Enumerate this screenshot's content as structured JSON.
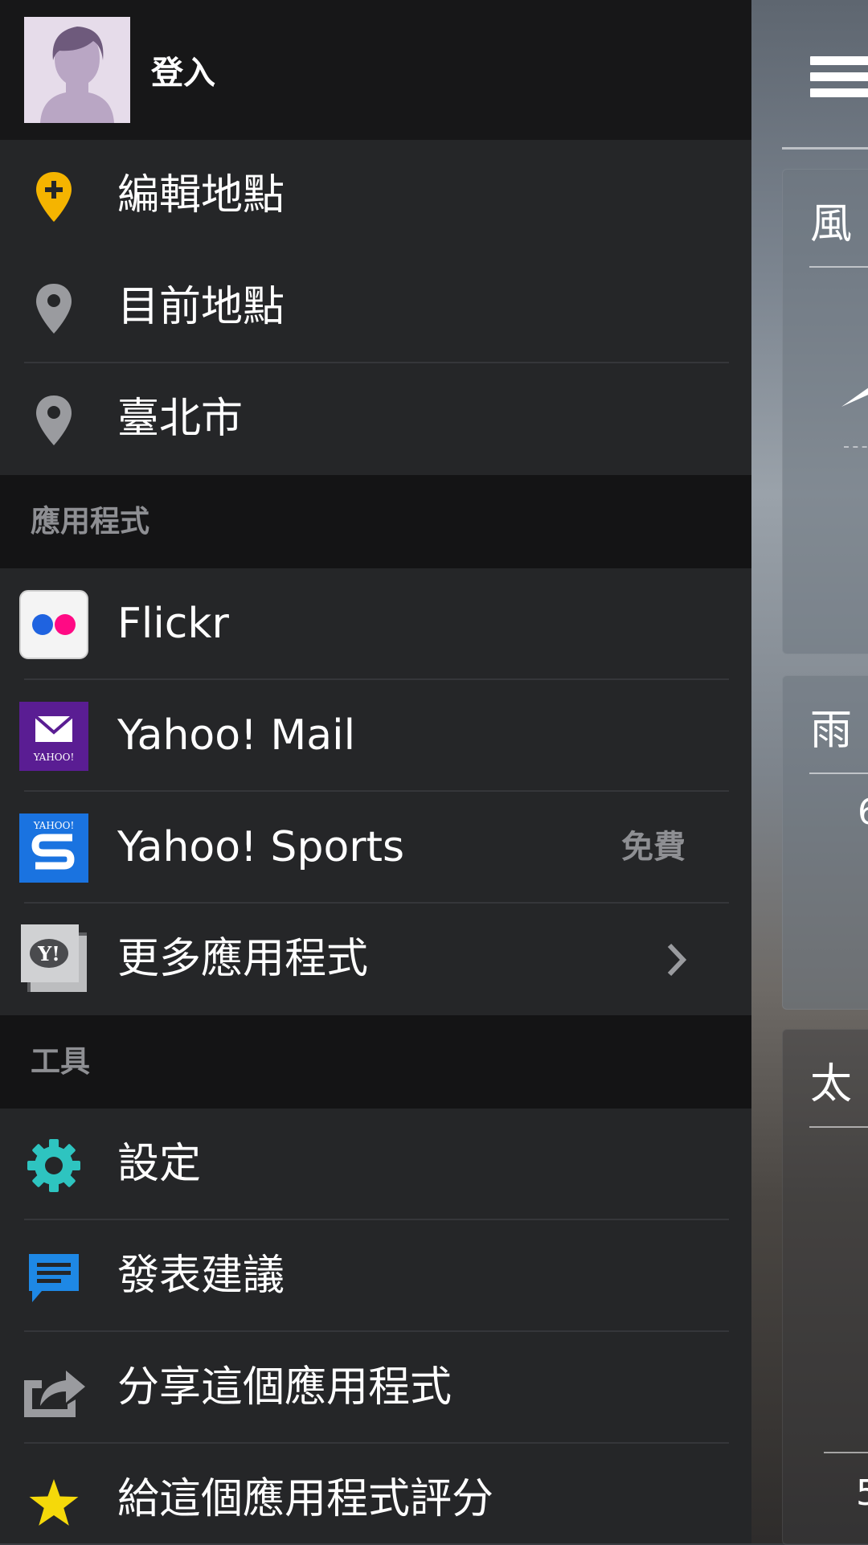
{
  "login": {
    "label": "登入"
  },
  "locations": [
    {
      "label": "編輯地點",
      "icon": "add-location-pin-icon",
      "color": "#f5b400"
    },
    {
      "label": "目前地點",
      "icon": "location-pin-icon",
      "color": "#9a9b9f"
    },
    {
      "label": "臺北市",
      "icon": "location-pin-icon",
      "color": "#9a9b9f"
    }
  ],
  "apps_section": {
    "header": "應用程式",
    "items": [
      {
        "label": "Flickr",
        "icon": "flickr-icon"
      },
      {
        "label": "Yahoo! Mail",
        "icon": "yahoo-mail-icon",
        "icon_text": "YAHOO!"
      },
      {
        "label": "Yahoo! Sports",
        "icon": "yahoo-sports-icon",
        "icon_text": "YAHOO!",
        "badge": "免費"
      },
      {
        "label": "更多應用程式",
        "icon": "yahoo-apps-icon",
        "icon_text": "Y!"
      }
    ]
  },
  "tools_section": {
    "header": "工具",
    "items": [
      {
        "label": "設定",
        "icon": "gear-icon",
        "color": "#2ec4c0"
      },
      {
        "label": "發表建議",
        "icon": "feedback-icon",
        "color": "#1e88e5"
      },
      {
        "label": "分享這個應用程式",
        "icon": "share-icon",
        "color": "#9a9b9f"
      },
      {
        "label": "給這個應用程式評分",
        "icon": "star-icon",
        "color": "#f5d90a"
      }
    ]
  },
  "background": {
    "card_titles": [
      "風",
      "雨",
      "太"
    ],
    "fragments": [
      "6",
      "5"
    ]
  },
  "colors": {
    "drawer_bg": "#252628",
    "header_bg": "#141415",
    "login_bg": "#171718",
    "text": "#ffffff",
    "muted": "#8e8f93"
  }
}
